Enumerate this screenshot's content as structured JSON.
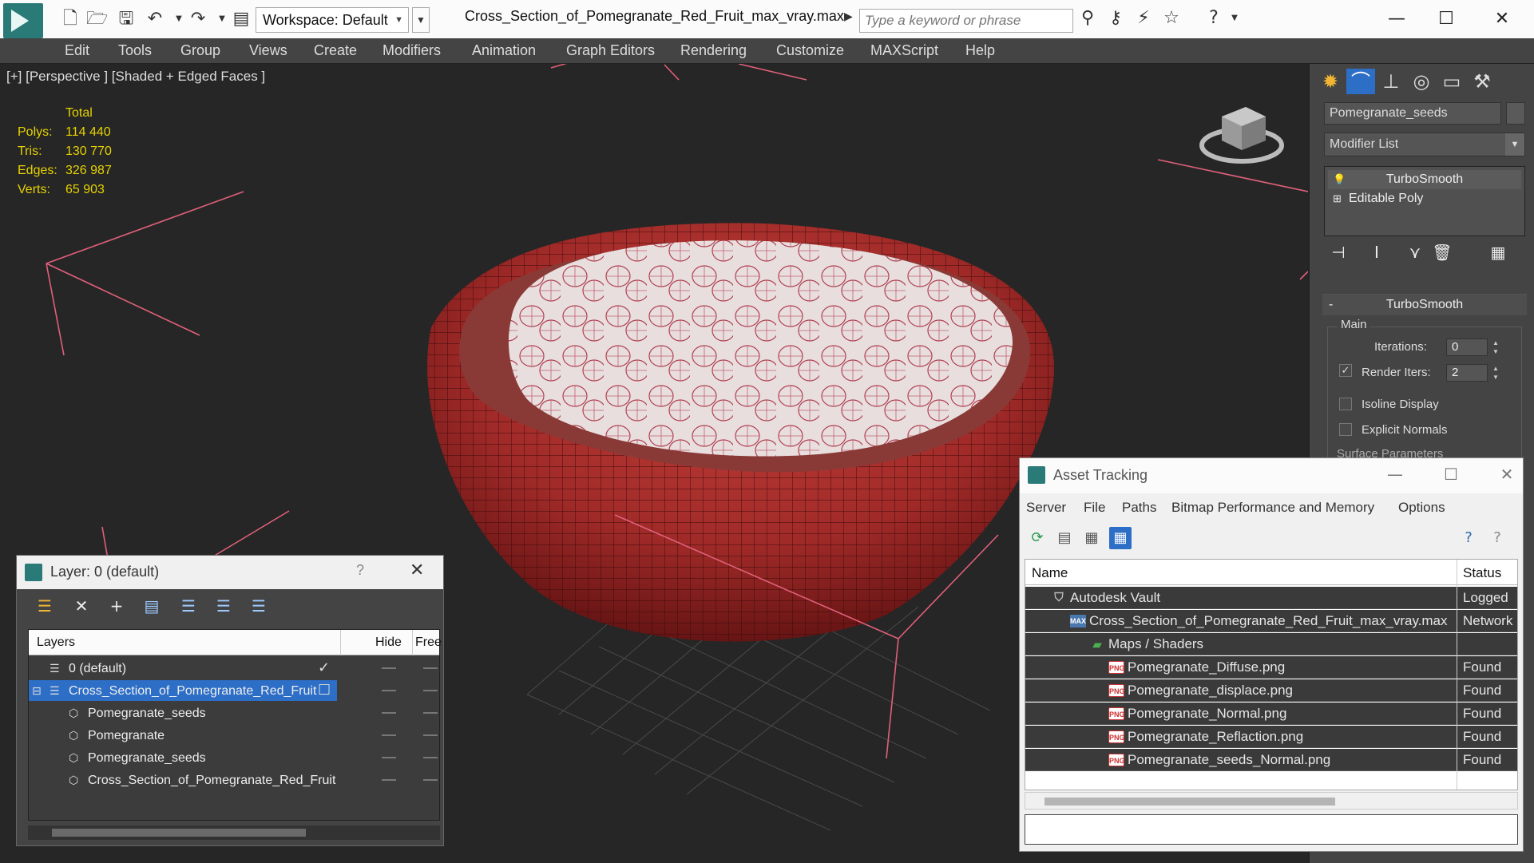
{
  "titlebar": {
    "workspace": "Workspace: Default",
    "window_title": "Cross_Section_of_Pomegranate_Red_Fruit_max_vray.max",
    "search_placeholder": "Type a keyword or phrase",
    "icons": [
      "new-file-icon",
      "open-file-icon",
      "save-icon",
      "undo-icon",
      "redo-icon",
      "project-icon"
    ]
  },
  "menubar": {
    "items": [
      "Edit",
      "Tools",
      "Group",
      "Views",
      "Create",
      "Modifiers",
      "Animation",
      "Graph Editors",
      "Rendering",
      "Customize",
      "MAXScript",
      "Help"
    ]
  },
  "viewport": {
    "label": "[+] [Perspective ] [Shaded + Edged Faces ]",
    "stats": {
      "header": "Total",
      "rows": [
        {
          "label": "Polys:",
          "value": "114 440"
        },
        {
          "label": "Tris:",
          "value": "130 770"
        },
        {
          "label": "Edges:",
          "value": "326 987"
        },
        {
          "label": "Verts:",
          "value": "65 903"
        }
      ]
    }
  },
  "command_panel": {
    "object_name": "Pomegranate_seeds",
    "modifier_list": "Modifier List",
    "stack": [
      "TurboSmooth",
      "Editable Poly"
    ],
    "rollout_title": "TurboSmooth",
    "group_label": "Main",
    "iterations_label": "Iterations:",
    "iterations_value": "0",
    "render_iters_label": "Render Iters:",
    "render_iters_value": "2",
    "isoline_label": "Isoline Display",
    "explicit_normals_label": "Explicit Normals",
    "surface_params_label": "Surface Parameters"
  },
  "layer_dialog": {
    "title": "Layer: 0 (default)",
    "help": "?",
    "columns": [
      "Layers",
      "Hide",
      "Free"
    ],
    "rows": [
      {
        "name": "0 (default)",
        "indent": 0,
        "kind": "layer",
        "selected": false,
        "active": true
      },
      {
        "name": "Cross_Section_of_Pomegranate_Red_Fruit",
        "indent": 0,
        "kind": "layer",
        "selected": true,
        "active": false
      },
      {
        "name": "Pomegranate_seeds",
        "indent": 1,
        "kind": "object",
        "selected": false,
        "active": false
      },
      {
        "name": "Pomegranate",
        "indent": 1,
        "kind": "object",
        "selected": false,
        "active": false
      },
      {
        "name": "Pomegranate_seeds",
        "indent": 1,
        "kind": "object",
        "selected": false,
        "active": false
      },
      {
        "name": "Cross_Section_of_Pomegranate_Red_Fruit",
        "indent": 1,
        "kind": "object",
        "selected": false,
        "active": false
      }
    ]
  },
  "asset_dialog": {
    "title": "Asset Tracking",
    "menu": [
      "Server",
      "File",
      "Paths",
      "Bitmap Performance and Memory",
      "Options"
    ],
    "columns": [
      "Name",
      "Status"
    ],
    "rows": [
      {
        "name": "Autodesk Vault",
        "status": "Logged",
        "indent": 1,
        "icon": "vault-icon"
      },
      {
        "name": "Cross_Section_of_Pomegranate_Red_Fruit_max_vray.max",
        "status": "Network",
        "indent": 2,
        "icon": "max-file-icon"
      },
      {
        "name": "Maps / Shaders",
        "status": "",
        "indent": 3,
        "icon": "maps-icon"
      },
      {
        "name": "Pomegranate_Diffuse.png",
        "status": "Found",
        "indent": 4,
        "icon": "png-icon"
      },
      {
        "name": "Pomegranate_displace.png",
        "status": "Found",
        "indent": 4,
        "icon": "png-icon"
      },
      {
        "name": "Pomegranate_Normal.png",
        "status": "Found",
        "indent": 4,
        "icon": "png-icon"
      },
      {
        "name": "Pomegranate_Reflaction.png",
        "status": "Found",
        "indent": 4,
        "icon": "png-icon"
      },
      {
        "name": "Pomegranate_seeds_Normal.png",
        "status": "Found",
        "indent": 4,
        "icon": "png-icon"
      }
    ]
  },
  "colors": {
    "accent": "#2d6ec7",
    "stats_yellow": "#e6d200",
    "fruit_red": "#a8302c",
    "gizmo_pink": "#e0607a"
  }
}
